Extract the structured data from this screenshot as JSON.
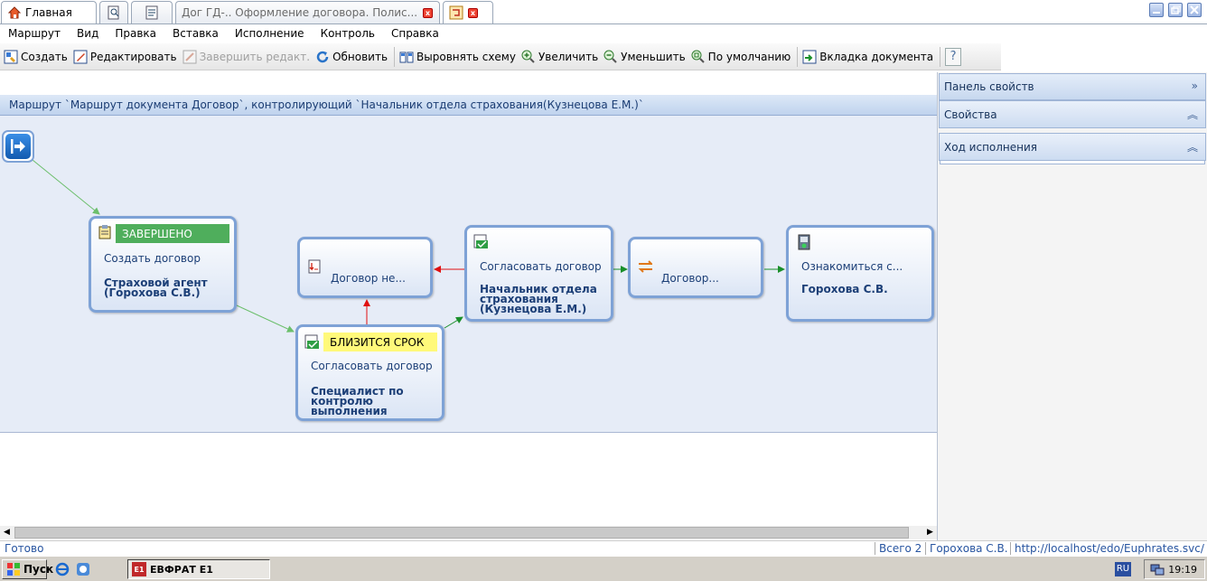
{
  "tabs": [
    {
      "label": "Главная"
    },
    {
      "label": "Дог ГД-..  Оформление договора. Полис..."
    }
  ],
  "menu": [
    "Маршрут",
    "Вид",
    "Правка",
    "Вставка",
    "Исполнение",
    "Контроль",
    "Справка"
  ],
  "toolbar": {
    "create": "Создать",
    "edit": "Редактировать",
    "finish_edit": "Завершить редакт.",
    "refresh": "Обновить",
    "align": "Выровнять схему",
    "zoom_in": "Увеличить",
    "zoom_out": "Уменьшить",
    "default": "По умолчанию",
    "doc_tab": "Вкладка документа",
    "help": "?"
  },
  "diagram": {
    "header": "Маршрут `Маршрут документа Договор`, контролирующий `Начальник отдела страхования(Кузнецова Е.М.)`",
    "nodes": {
      "n1": {
        "status": "ЗАВЕРШЕНО",
        "title": "Создать договор",
        "line1": "Страховой агент",
        "line2": "(Горохова С.В.)"
      },
      "n2": {
        "title": "Договор не..."
      },
      "n3": {
        "status": "БЛИЗИТСЯ СРОК",
        "title": "Согласовать договор",
        "line1": "Специалист по",
        "line2": "контролю",
        "line3": "выполнения"
      },
      "n4": {
        "title": "Согласовать договор",
        "line1": "Начальник отдела",
        "line2": "страхования",
        "line3": "(Кузнецова Е.М.)"
      },
      "n5": {
        "title": "Договор..."
      },
      "n6": {
        "title": "Ознакомиться с...",
        "line1": "Горохова С.В."
      }
    },
    "colors": {
      "done": "#4fae5c",
      "due_soon": "#fff97a",
      "arrow_green": "#1a8f2a",
      "arrow_red": "#e01010"
    }
  },
  "panel": {
    "title": "Панель свойств",
    "properties": "Свойства",
    "progress": "Ход исполнения"
  },
  "statusbar": {
    "ready": "Готово",
    "total": "Всего 2",
    "user": "Горохова С.В.",
    "url": "http://localhost/edo/Euphrates.svc/"
  },
  "taskbar": {
    "start": "Пуск",
    "app": "ЕВФРАТ E1",
    "lang": "RU",
    "time": "19:19"
  }
}
